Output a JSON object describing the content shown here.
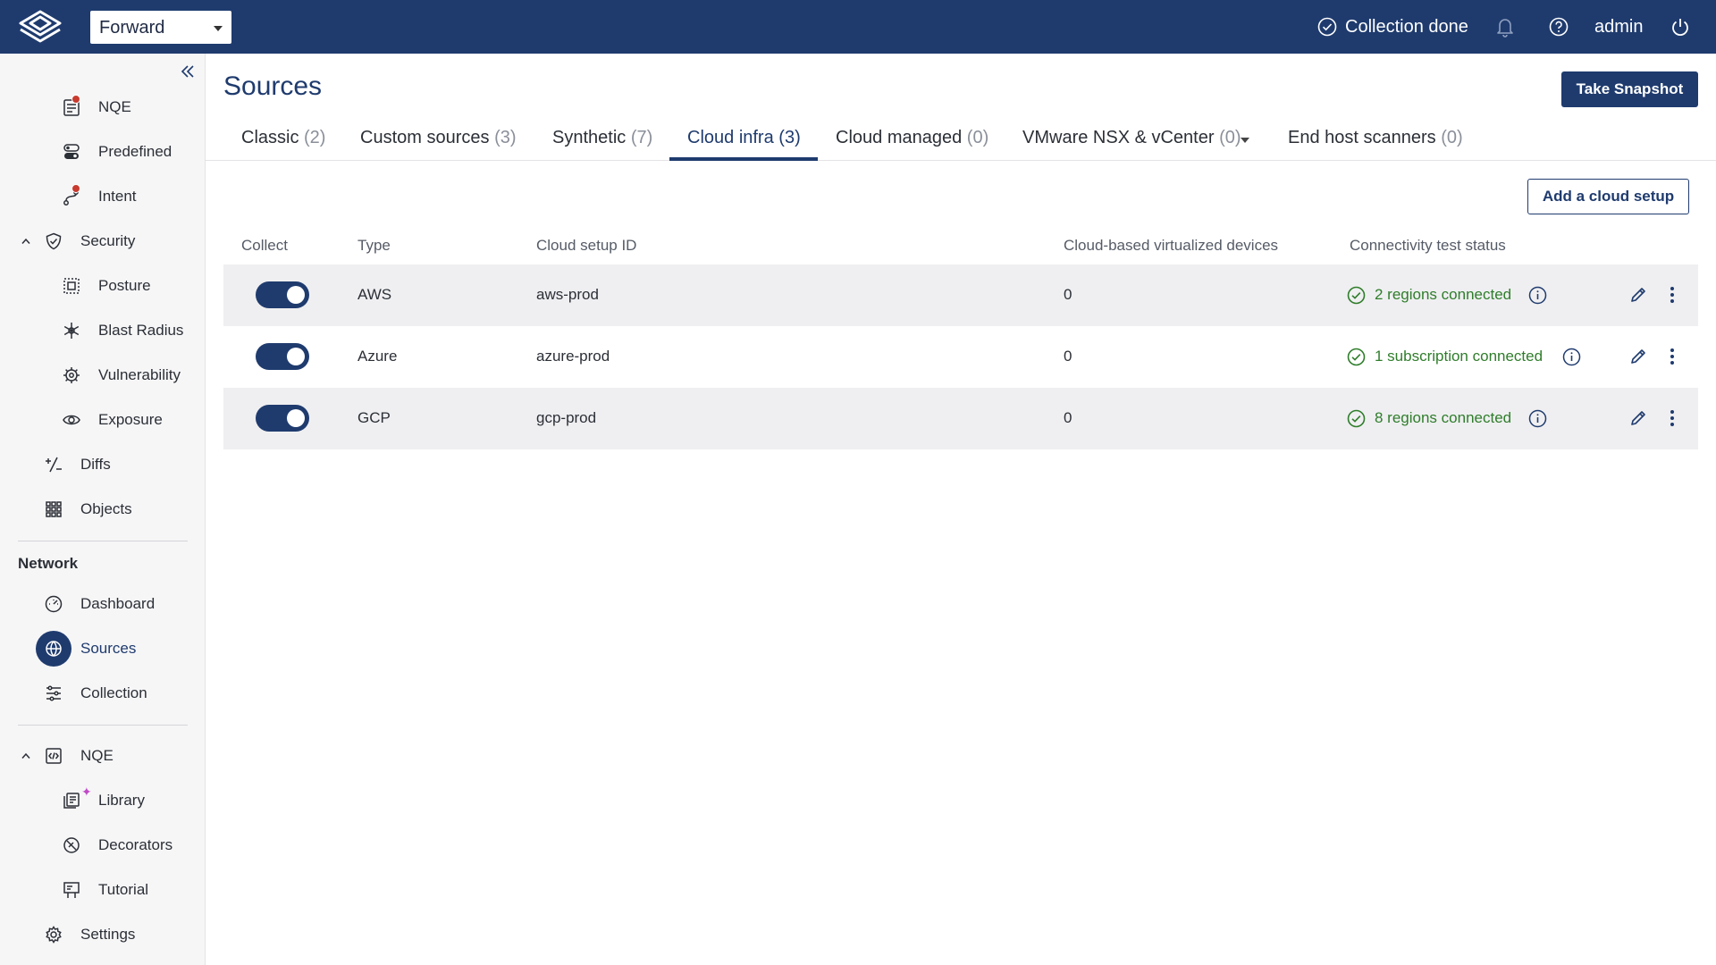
{
  "header": {
    "network_selector": "Forward",
    "collection_status": "Collection done",
    "user": "admin"
  },
  "sidebar": {
    "items_top": [
      {
        "label": "NQE",
        "icon": "nqe-report-icon",
        "badge": true
      },
      {
        "label": "Predefined",
        "icon": "predefined-icon"
      },
      {
        "label": "Intent",
        "icon": "intent-icon",
        "badge": true
      }
    ],
    "security": {
      "label": "Security",
      "items": [
        {
          "label": "Posture",
          "icon": "posture-icon"
        },
        {
          "label": "Blast Radius",
          "icon": "blast-radius-icon"
        },
        {
          "label": "Vulnerability",
          "icon": "vulnerability-icon"
        },
        {
          "label": "Exposure",
          "icon": "exposure-icon"
        }
      ]
    },
    "diffs": "Diffs",
    "objects": "Objects",
    "network": {
      "title": "Network",
      "items": [
        {
          "label": "Dashboard",
          "icon": "dashboard-icon"
        },
        {
          "label": "Sources",
          "icon": "sources-icon",
          "active": true
        },
        {
          "label": "Collection",
          "icon": "collection-icon"
        }
      ]
    },
    "nqe": {
      "label": "NQE",
      "items": [
        {
          "label": "Library",
          "icon": "library-icon"
        },
        {
          "label": "Decorators",
          "icon": "decorators-icon"
        },
        {
          "label": "Tutorial",
          "icon": "tutorial-icon"
        }
      ]
    },
    "settings": "Settings"
  },
  "page": {
    "title": "Sources",
    "take_snapshot": "Take Snapshot",
    "add_cloud_setup": "Add a cloud setup"
  },
  "tabs": [
    {
      "label": "Classic",
      "count": "(2)"
    },
    {
      "label": "Custom sources",
      "count": "(3)"
    },
    {
      "label": "Synthetic",
      "count": "(7)"
    },
    {
      "label": "Cloud infra",
      "count": "(3)",
      "active": true
    },
    {
      "label": "Cloud managed",
      "count": "(0)"
    },
    {
      "label": "VMware NSX & vCenter",
      "count": "(0)"
    },
    {
      "label": "End host scanners",
      "count": "(0)"
    }
  ],
  "table": {
    "columns": [
      "Collect",
      "Type",
      "Cloud setup ID",
      "Cloud-based virtualized devices",
      "Connectivity test status"
    ],
    "rows": [
      {
        "collect": true,
        "type": "AWS",
        "setup_id": "aws-prod",
        "devices": "0",
        "status": "2 regions connected"
      },
      {
        "collect": true,
        "type": "Azure",
        "setup_id": "azure-prod",
        "devices": "0",
        "status": "1 subscription connected"
      },
      {
        "collect": true,
        "type": "GCP",
        "setup_id": "gcp-prod",
        "devices": "0",
        "status": "8 regions connected"
      }
    ]
  },
  "colors": {
    "brand": "#1f3b6e",
    "success": "#2f7d2b",
    "badge": "#c83a2e"
  }
}
